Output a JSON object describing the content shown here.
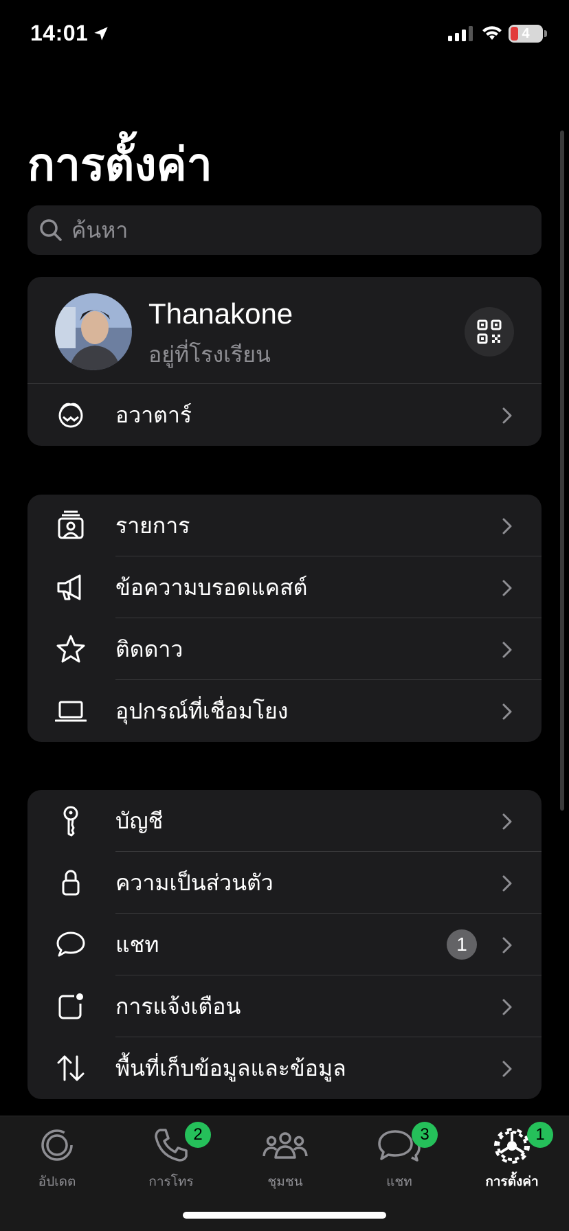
{
  "status_bar": {
    "time": "14:01",
    "battery": "4"
  },
  "page": {
    "title": "การตั้งค่า"
  },
  "search": {
    "placeholder": "ค้นหา"
  },
  "profile": {
    "name": "Thanakone",
    "status": "อยู่ที่โรงเรียน",
    "avatar_row_label": "อวาตาร์"
  },
  "tools": [
    {
      "label": "รายการ",
      "icon": "lists-icon"
    },
    {
      "label": "ข้อความบรอดแคสต์",
      "icon": "megaphone-icon"
    },
    {
      "label": "ติดดาว",
      "icon": "star-icon"
    },
    {
      "label": "อุปกรณ์ที่เชื่อมโยง",
      "icon": "laptop-icon"
    }
  ],
  "settings": [
    {
      "label": "บัญชี",
      "icon": "key-icon"
    },
    {
      "label": "ความเป็นส่วนตัว",
      "icon": "lock-icon"
    },
    {
      "label": "แชท",
      "icon": "chat-bubble-icon",
      "badge": "1"
    },
    {
      "label": "การแจ้งเตือน",
      "icon": "notification-icon"
    },
    {
      "label": "พื้นที่เก็บข้อมูลและข้อมูล",
      "icon": "storage-arrows-icon"
    }
  ],
  "tabbar": [
    {
      "label": "อัปเดต",
      "icon": "updates-icon",
      "badge": ""
    },
    {
      "label": "การโทร",
      "icon": "phone-icon",
      "badge": "2"
    },
    {
      "label": "ชุมชน",
      "icon": "communities-icon",
      "badge": ""
    },
    {
      "label": "แชท",
      "icon": "chats-icon",
      "badge": "3"
    },
    {
      "label": "การตั้งค่า",
      "icon": "settings-gear-icon",
      "badge": "1",
      "active": true
    }
  ],
  "colors": {
    "background": "#000000",
    "card": "#1c1c1e",
    "badge_green": "#25c05a",
    "secondary_text": "#8e8e93"
  }
}
